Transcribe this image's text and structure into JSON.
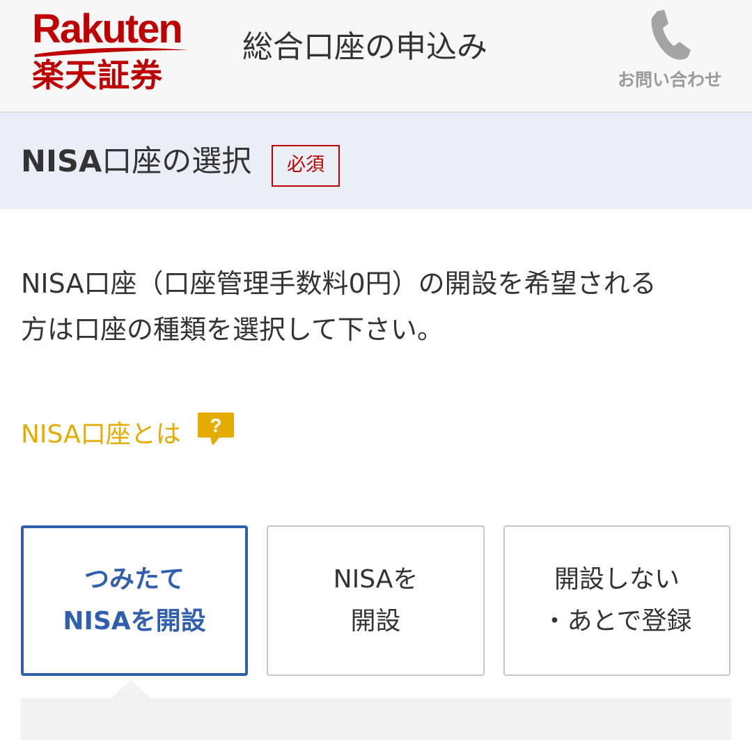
{
  "header": {
    "logo_word": "Rakuten",
    "logo_jp": "楽天証券",
    "title": "総合口座の申込み",
    "contact_label": "お問い合わせ",
    "contact_icon": "phone-icon"
  },
  "section": {
    "title_latin": "NISA",
    "title_jp": "口座の選択",
    "required_badge": "必須"
  },
  "description": {
    "line1": "NISA口座（口座管理手数料0円）の開設を希望される",
    "line2": "方は口座の種類を選択して下さい。"
  },
  "help_link": {
    "label": "NISA口座とは",
    "icon": "question-bubble-icon",
    "icon_glyph": "?"
  },
  "options": [
    {
      "line1": "つみたて",
      "line2": "NISAを開設",
      "selected": true
    },
    {
      "line1": "NISAを",
      "line2": "開設",
      "selected": false
    },
    {
      "line1": "開設しない",
      "line2": "・あとで登録",
      "selected": false
    }
  ],
  "colors": {
    "brand_red": "#bf0000",
    "accent_blue": "#2f5fae",
    "link_yellow": "#e5ac00",
    "section_bg": "#eaeef6"
  }
}
